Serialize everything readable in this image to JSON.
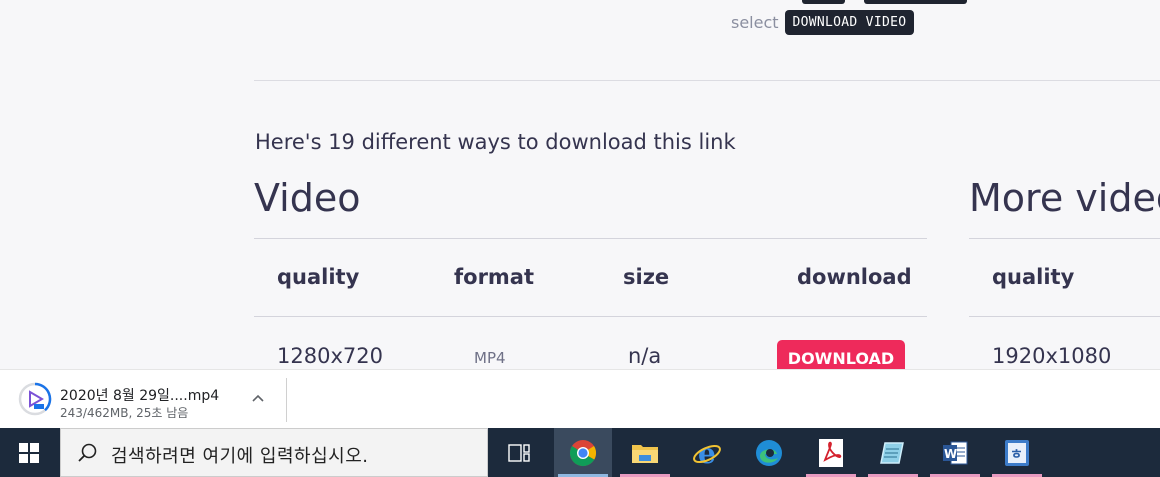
{
  "page": {
    "select_label": "select",
    "select_key": "DOWNLOAD VIDEO",
    "ways_text": "Here's 19 different ways to download this link"
  },
  "video_section": {
    "title": "Video",
    "headers": {
      "quality": "quality",
      "format": "format",
      "size": "size",
      "download": "download"
    },
    "row": {
      "quality": "1280x720",
      "format": "MP4",
      "size": "n/a",
      "download_label": "DOWNLOAD"
    }
  },
  "more_section": {
    "title": "More video",
    "header_quality": "quality",
    "row_quality": "1920x1080"
  },
  "download_bar": {
    "file_name": "2020년 8월 29일....mp4",
    "status": "243/462MB, 25초 남음"
  },
  "taskbar": {
    "search_placeholder": "검색하려면 여기에 입력하십시오.",
    "apps": [
      "task-view",
      "chrome",
      "file-explorer",
      "internet-explorer",
      "edge",
      "acrobat",
      "notepad",
      "word",
      "hangul"
    ]
  },
  "colors": {
    "accent_button": "#ee2a5b",
    "text_primary": "#35344f",
    "taskbar_bg": "#1c2a3c"
  }
}
